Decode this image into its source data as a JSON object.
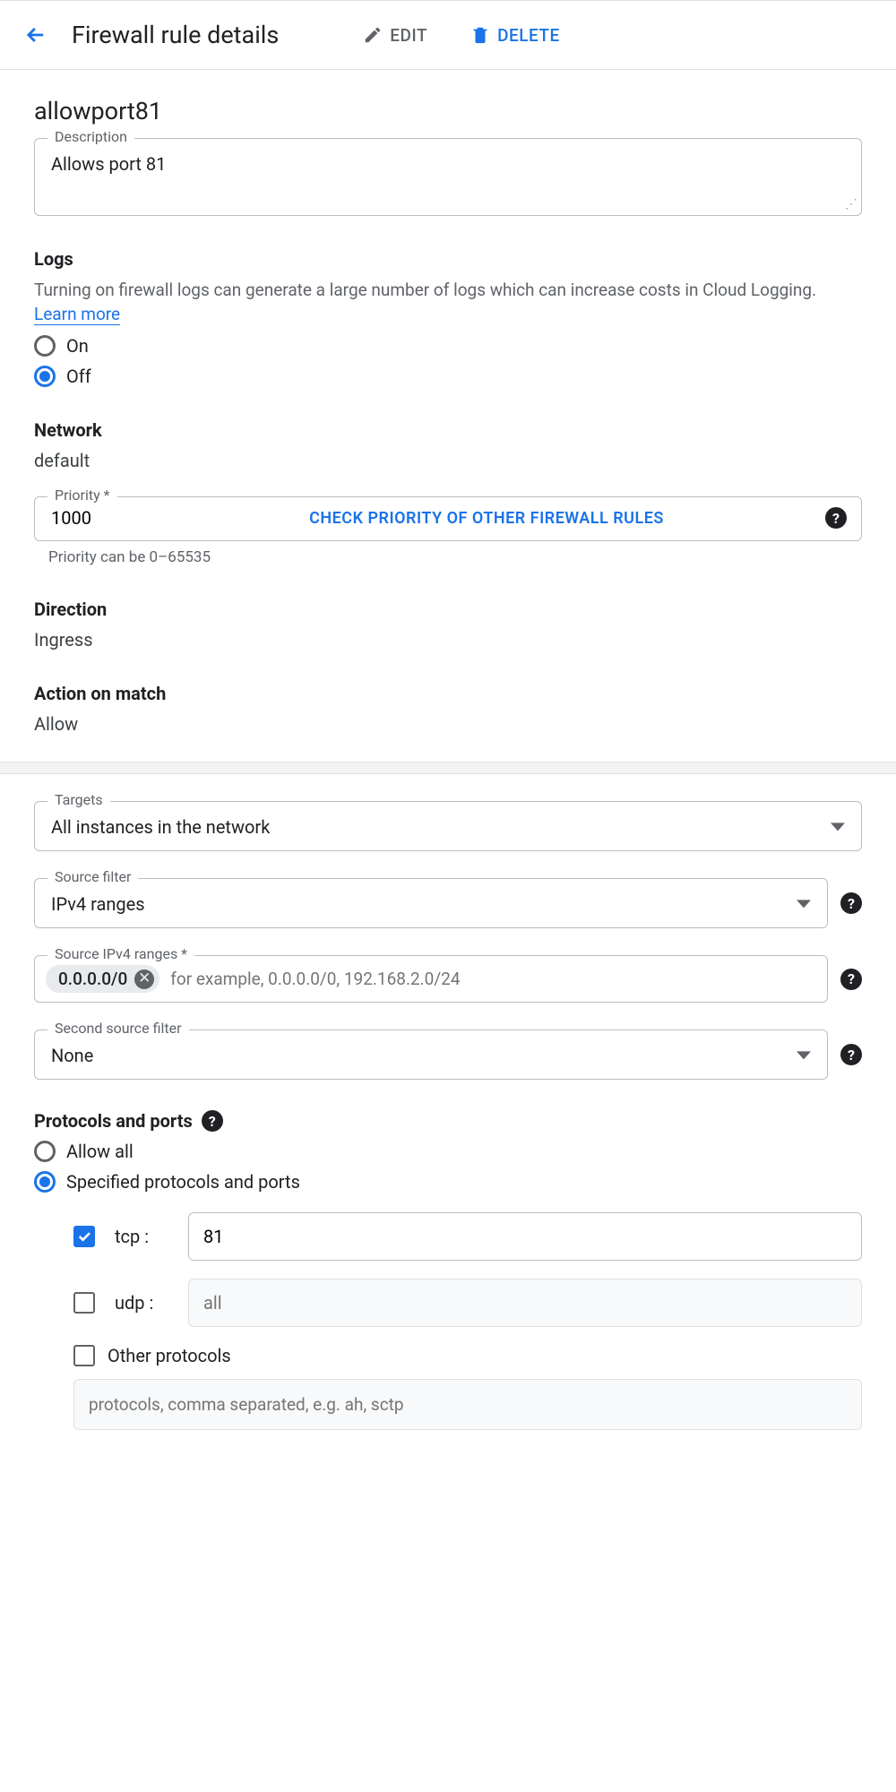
{
  "header": {
    "title": "Firewall rule details",
    "edit_label": "EDIT",
    "delete_label": "DELETE"
  },
  "rule": {
    "name": "allowport81",
    "description_label": "Description",
    "description_value": "Allows port 81"
  },
  "logs": {
    "title": "Logs",
    "helper": "Turning on firewall logs can generate a large number of logs which can increase costs in Cloud Logging.",
    "learn_more": "Learn more",
    "on_label": "On",
    "off_label": "Off",
    "selected": "off"
  },
  "network": {
    "title": "Network",
    "value": "default"
  },
  "priority": {
    "label": "Priority *",
    "value": "1000",
    "check_link": "CHECK PRIORITY OF OTHER FIREWALL RULES",
    "helper": "Priority can be 0–65535"
  },
  "direction": {
    "title": "Direction",
    "value": "Ingress"
  },
  "action": {
    "title": "Action on match",
    "value": "Allow"
  },
  "targets": {
    "label": "Targets",
    "value": "All instances in the network"
  },
  "source_filter": {
    "label": "Source filter",
    "value": "IPv4 ranges"
  },
  "source_ranges": {
    "label": "Source IPv4 ranges *",
    "chip": "0.0.0.0/0",
    "placeholder": "for example, 0.0.0.0/0, 192.168.2.0/24"
  },
  "second_filter": {
    "label": "Second source filter",
    "value": "None"
  },
  "protocols": {
    "title": "Protocols and ports",
    "allow_all": "Allow all",
    "specified": "Specified protocols and ports",
    "selected": "specified",
    "tcp": {
      "label": "tcp :",
      "checked": true,
      "value": "81"
    },
    "udp": {
      "label": "udp :",
      "checked": false,
      "placeholder": "all"
    },
    "other": {
      "label": "Other protocols",
      "checked": false,
      "placeholder": "protocols, comma separated, e.g. ah, sctp"
    }
  }
}
